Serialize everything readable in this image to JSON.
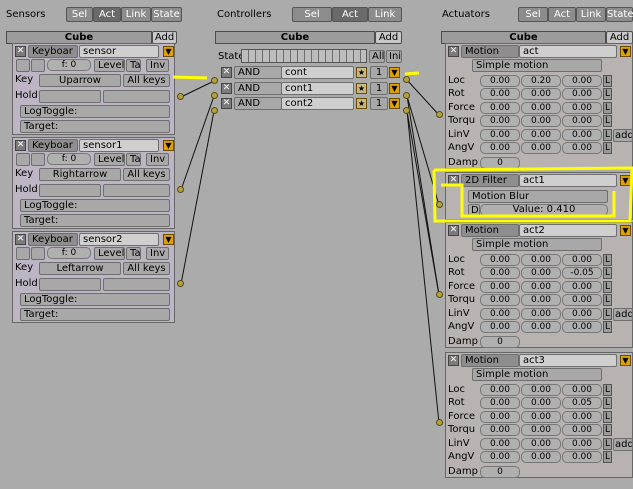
{
  "header": {
    "sensors_label": "Sensors",
    "controllers_label": "Controllers",
    "actuators_label": "Actuators",
    "sel": "Sel",
    "act": "Act",
    "link": "Link",
    "state": "State",
    "sensors_buttons": [
      "Sel",
      "Act",
      "Link",
      "State"
    ],
    "controllers_buttons": [
      "Sel",
      "Act",
      "Link"
    ],
    "actuators_buttons": [
      "Sel",
      "Act",
      "Link",
      "State"
    ]
  },
  "object_name": "Cube",
  "add_label": "Add",
  "sensors": [
    {
      "type": "Keyboar",
      "name": "sensor",
      "freq": "f: 0",
      "level": "Level",
      "tap": "Ta",
      "inv": "Inv",
      "key_label": "Key",
      "key": "Uparrow",
      "all_keys": "All keys",
      "hold_label": "Hold",
      "logtoggle": "LogToggle:",
      "target": "Target:"
    },
    {
      "type": "Keyboar",
      "name": "sensor1",
      "freq": "f: 0",
      "level": "Level",
      "tap": "Ta",
      "inv": "Inv",
      "key_label": "Key",
      "key": "Rightarrow",
      "all_keys": "All keys",
      "hold_label": "Hold",
      "logtoggle": "LogToggle:",
      "target": "Target:"
    },
    {
      "type": "Keyboar",
      "name": "sensor2",
      "freq": "f: 0",
      "level": "Level",
      "tap": "Ta",
      "inv": "Inv",
      "key_label": "Key",
      "key": "Leftarrow",
      "all_keys": "All keys",
      "hold_label": "Hold",
      "logtoggle": "LogToggle:",
      "target": "Target:"
    }
  ],
  "controllers": {
    "state_label": "State",
    "all": "All",
    "ini": "Ini",
    "items": [
      {
        "type": "AND",
        "name": "cont",
        "state": "1"
      },
      {
        "type": "AND",
        "name": "cont1",
        "state": "1"
      },
      {
        "type": "AND",
        "name": "cont2",
        "state": "1"
      }
    ]
  },
  "actuators": [
    {
      "type": "Motion",
      "name": "act",
      "mode": "Simple motion",
      "rows": [
        {
          "label": "Loc",
          "values": [
            "0.00",
            "0.20",
            "0.00"
          ]
        },
        {
          "label": "Rot",
          "values": [
            "0.00",
            "0.00",
            "0.00"
          ]
        },
        {
          "label": "Force",
          "values": [
            "0.00",
            "0.00",
            "0.00"
          ]
        },
        {
          "label": "Torqu",
          "values": [
            "0.00",
            "0.00",
            "0.00"
          ]
        },
        {
          "label": "LinV",
          "values": [
            "0.00",
            "0.00",
            "0.00"
          ]
        },
        {
          "label": "AngV",
          "values": [
            "0.00",
            "0.00",
            "0.00"
          ]
        }
      ],
      "damp_label": "Damp",
      "damp": "0",
      "add": "add",
      "l": "L"
    },
    {
      "type": "2D Filter",
      "name": "act1",
      "filter": "Motion Blur",
      "d_label": "D",
      "value_label": "Value: 0.410"
    },
    {
      "type": "Motion",
      "name": "act2",
      "mode": "Simple motion",
      "rows": [
        {
          "label": "Loc",
          "values": [
            "0.00",
            "0.00",
            "0.00"
          ]
        },
        {
          "label": "Rot",
          "values": [
            "0.00",
            "0.00",
            "-0.05"
          ]
        },
        {
          "label": "Force",
          "values": [
            "0.00",
            "0.00",
            "0.00"
          ]
        },
        {
          "label": "Torqu",
          "values": [
            "0.00",
            "0.00",
            "0.00"
          ]
        },
        {
          "label": "LinV",
          "values": [
            "0.00",
            "0.00",
            "0.00"
          ]
        },
        {
          "label": "AngV",
          "values": [
            "0.00",
            "0.00",
            "0.00"
          ]
        }
      ],
      "damp_label": "Damp",
      "damp": "0",
      "add": "add",
      "l": "L"
    },
    {
      "type": "Motion",
      "name": "act3",
      "mode": "Simple motion",
      "rows": [
        {
          "label": "Loc",
          "values": [
            "0.00",
            "0.00",
            "0.00"
          ]
        },
        {
          "label": "Rot",
          "values": [
            "0.00",
            "0.00",
            "0.05"
          ]
        },
        {
          "label": "Force",
          "values": [
            "0.00",
            "0.00",
            "0.00"
          ]
        },
        {
          "label": "Torqu",
          "values": [
            "0.00",
            "0.00",
            "0.00"
          ]
        },
        {
          "label": "LinV",
          "values": [
            "0.00",
            "0.00",
            "0.00"
          ]
        },
        {
          "label": "AngV",
          "values": [
            "0.00",
            "0.00",
            "0.00"
          ]
        }
      ],
      "damp_label": "Damp",
      "damp": "0",
      "add": "add",
      "l": "L"
    }
  ],
  "colors": {
    "background": "#ababab",
    "highlight": "#ffff00",
    "sensor_panel": "#bdb5c4",
    "link_dot": "#b4a040"
  }
}
